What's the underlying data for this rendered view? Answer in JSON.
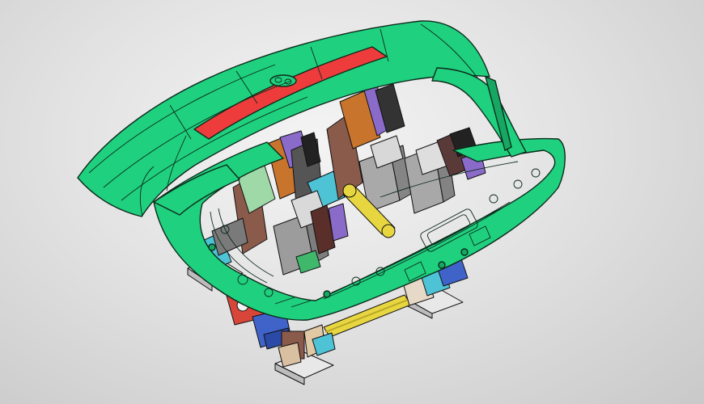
{
  "viewport": {
    "background": "#dcdcdc"
  },
  "model": {
    "colors": {
      "body_panel": "#1fd07e",
      "body_panel_shade": "#16a863",
      "stripe": "#ee3b3b",
      "support_bar": "#e8d640",
      "clamp_orange": "#c8742c",
      "clamp_purple": "#8a6bc9",
      "clamp_gray": "#9c9c9c",
      "base_blue": "#3f63c9",
      "base_red": "#d8463a",
      "locator_cyan": "#4ec3d6",
      "rubber_brown": "#8a5a4a"
    },
    "icons": [
      "fixture-assembly",
      "clamp-unit",
      "support-rail",
      "base-plate"
    ]
  }
}
